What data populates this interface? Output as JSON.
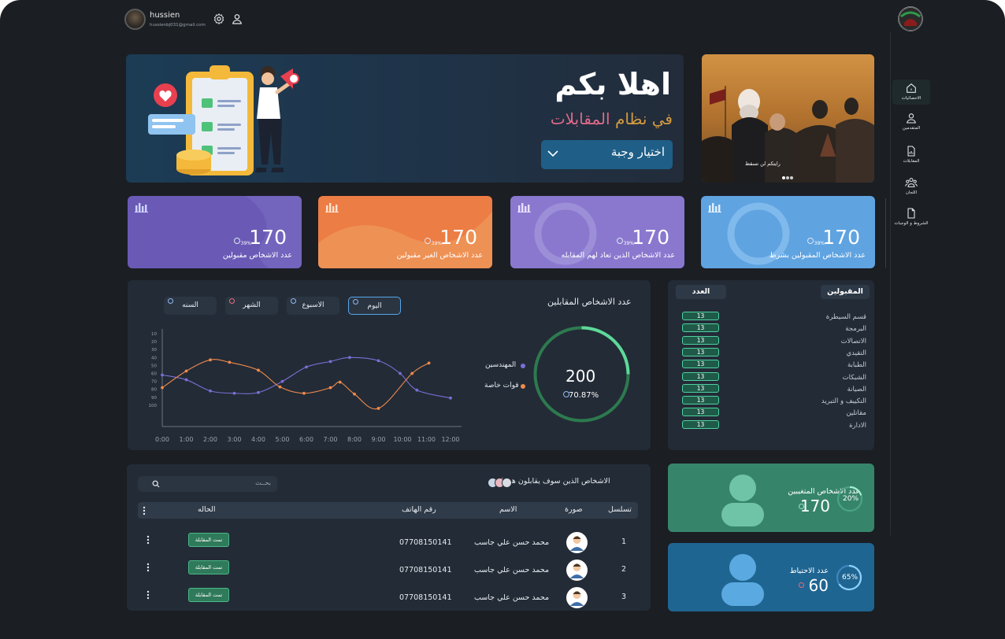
{
  "user": {
    "name": "hussien",
    "email": "hussienbj031@gmail.com"
  },
  "sidebar": {
    "items": [
      {
        "label": "الاحصائيات",
        "icon": "home-icon"
      },
      {
        "label": "المتقدمين",
        "icon": "user-icon"
      },
      {
        "label": "المقابلات",
        "icon": "document-chart-icon"
      },
      {
        "label": "اللجان",
        "icon": "group-icon"
      },
      {
        "label": "الشروط و الوجبات",
        "icon": "file-icon"
      }
    ]
  },
  "hero": {
    "title": "اهلا بكم",
    "subtitle_prefix": "في نظام ",
    "subtitle_accent": "المقابلات",
    "select_label": "اختيار وجبة"
  },
  "photo": {
    "caption": "رايتكم لن تسقط"
  },
  "stats": [
    {
      "value": "170",
      "percent": "39%",
      "label": "عدد الاشخاص  مقبولين",
      "color": "#6a5ab6"
    },
    {
      "value": "170",
      "percent": "39%",
      "label": "عدد الاشخاص الغير مقبولين",
      "color": "#ec7d44"
    },
    {
      "value": "170",
      "percent": "39%",
      "label": "عدد الاشخاص الذين تعاد لهم المقابله",
      "color": "#8a78cf"
    },
    {
      "value": "170",
      "percent": "39%",
      "label": "عدد الاشخاص المقبولين بشرط",
      "color": "#5fa3e1"
    }
  ],
  "interviews": {
    "title": "عدد الاشخاص المقابلين",
    "tabs": [
      "اليوم",
      "الاسبوع",
      "الشهر",
      "السنه"
    ],
    "active_tab": "اليوم",
    "total": "200",
    "percent": "70.87%",
    "legend": [
      {
        "label": "المهندسين",
        "color": "#7a6fd6"
      },
      {
        "label": "قوات خاصة",
        "color": "#f08a4c"
      }
    ]
  },
  "chart_data": {
    "type": "line",
    "x": [
      "0:00",
      "1:00",
      "2:00",
      "3:00",
      "4:00",
      "5:00",
      "6:00",
      "7:00",
      "8:00",
      "9:00",
      "10:00",
      "11:00",
      "12:00"
    ],
    "y_ticks": [
      "10",
      "20",
      "30",
      "40",
      "50",
      "60",
      "70",
      "80",
      "90",
      "100"
    ],
    "series": [
      {
        "name": "المهندسين",
        "color": "#7a6fd6",
        "points": [
          [
            0,
            62
          ],
          [
            1,
            68
          ],
          [
            2,
            82
          ],
          [
            3,
            85
          ],
          [
            4,
            84
          ],
          [
            5,
            70
          ],
          [
            6,
            52
          ],
          [
            7,
            45
          ],
          [
            7.8,
            40
          ],
          [
            9,
            44
          ],
          [
            9.9,
            60
          ],
          [
            10.6,
            81
          ],
          [
            12,
            91
          ]
        ]
      },
      {
        "name": "قوات خاصة",
        "color": "#f08a4c",
        "points": [
          [
            0,
            78
          ],
          [
            1,
            57
          ],
          [
            2,
            43
          ],
          [
            2.8,
            46
          ],
          [
            4,
            56
          ],
          [
            4.9,
            77
          ],
          [
            5.9,
            85
          ],
          [
            7,
            78
          ],
          [
            7.4,
            71
          ],
          [
            8,
            86
          ],
          [
            9,
            104
          ],
          [
            10.4,
            60
          ],
          [
            11.1,
            47
          ]
        ]
      }
    ]
  },
  "accepted": {
    "header_name": "المقبولين",
    "header_count": "العدد",
    "rows": [
      {
        "name": "قسم السيطرة",
        "count": "13"
      },
      {
        "name": "البرمجة",
        "count": "13"
      },
      {
        "name": "الاتصالات",
        "count": "13"
      },
      {
        "name": "التقيدي",
        "count": "13"
      },
      {
        "name": "الطبابة",
        "count": "13"
      },
      {
        "name": "الشبكات",
        "count": "13"
      },
      {
        "name": "الصيانة",
        "count": "13"
      },
      {
        "name": "التكييف و التبريد",
        "count": "13"
      },
      {
        "name": "مقاتلين",
        "count": "13"
      },
      {
        "name": "الادارة",
        "count": "13"
      }
    ]
  },
  "today": {
    "title": "الاشخاص الذين سوف يقابلون هذا اليوم",
    "search_placeholder": "بحــث",
    "columns": {
      "serial": "تسلسل",
      "photo": "صورة",
      "name": "الاسم",
      "phone": "رقم الهاتف",
      "status": "الحاله"
    },
    "rows": [
      {
        "serial": "1",
        "name": "محمد حسن علي جاسب",
        "phone": "07708150141",
        "status": "تمت المقابلة"
      },
      {
        "serial": "2",
        "name": "محمد حسن علي جاسب",
        "phone": "07708150141",
        "status": "تمت المقابلة"
      },
      {
        "serial": "3",
        "name": "محمد حسن علي جاسب",
        "phone": "07708150141",
        "status": "تمت المقابلة"
      }
    ]
  },
  "absent": {
    "label": "عدد الاشخاص المتغيبين",
    "value": "170",
    "percent": "20%"
  },
  "reserve": {
    "label": "عدد الاحتياط",
    "value": "60",
    "percent": "65%"
  }
}
